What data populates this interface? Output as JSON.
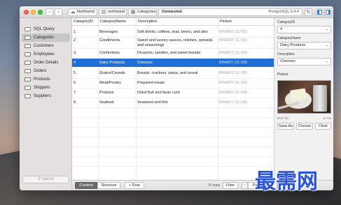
{
  "toolbar": {
    "tab1": "Northwind",
    "tab2": "northwind",
    "tab3": "Categories",
    "status_left": "Connected.",
    "status_right": "PostgreSQL 9.4.4"
  },
  "sidebar": {
    "items": [
      {
        "label": "SQL Query"
      },
      {
        "label": "Categories"
      },
      {
        "label": "Customers"
      },
      {
        "label": "Employees"
      },
      {
        "label": "Order Details"
      },
      {
        "label": "Orders"
      },
      {
        "label": "Products"
      },
      {
        "label": "Shippers"
      },
      {
        "label": "Suppliers"
      }
    ],
    "selected_index": 1,
    "search_placeholder": "Search"
  },
  "table": {
    "columns": [
      "CategoryID",
      "CategoryName",
      "Description",
      "Picture"
    ],
    "rows": [
      {
        "id": "1",
        "name": "Beverages",
        "desc": "Soft drinks, coffees, teas, beers, and ales",
        "pic": "BINARY (11 KB)"
      },
      {
        "id": "2",
        "name": "Condiments",
        "desc": "Sweet and savory sauces, relishes, spreads, and seasonings",
        "pic": "BINARY (11 KB)"
      },
      {
        "id": "3",
        "name": "Confections",
        "desc": "Desserts, candies, and sweet breads",
        "pic": "BINARY (11 KB)"
      },
      {
        "id": "4",
        "name": "Dairy Products",
        "desc": "Cheeses",
        "pic": "BINARY (11 KB)"
      },
      {
        "id": "5",
        "name": "Grains/Cereals",
        "desc": "Breads, crackers, pasta, and cereal",
        "pic": "BINARY (11 KB)"
      },
      {
        "id": "6",
        "name": "Meat/Poultry",
        "desc": "Prepared meats",
        "pic": "BINARY (11 KB)"
      },
      {
        "id": "7",
        "name": "Produce",
        "desc": "Dried fruit and bean curd",
        "pic": "BINARY (11 KB)"
      },
      {
        "id": "8",
        "name": "Seafood",
        "desc": "Seaweed and fish",
        "pic": "BINARY (11 KB)"
      }
    ],
    "selected_row": 3
  },
  "bottom": {
    "content": "Content",
    "structure": "Structure",
    "add_row": "+ Row",
    "row_count": "8 rows",
    "filter": "Filter",
    "page": "Page 1 of 1"
  },
  "detail": {
    "label_id": "CategoryID",
    "value_id": "4",
    "label_name": "CategoryName",
    "value_name": "Dairy Products",
    "label_desc": "Description",
    "value_desc": "Cheeses",
    "label_pic": "Picture",
    "pic_meta_left": "BMP file",
    "pic_meta_right": "11 KB",
    "btn_save": "Save As",
    "btn_choose": "Choose",
    "btn_clear": "Clear"
  },
  "watermark": "最需网",
  "colors": {
    "selection": "#1f6fd6",
    "blob_text": "#a8a8a8",
    "watermark": "#2b53d8"
  }
}
